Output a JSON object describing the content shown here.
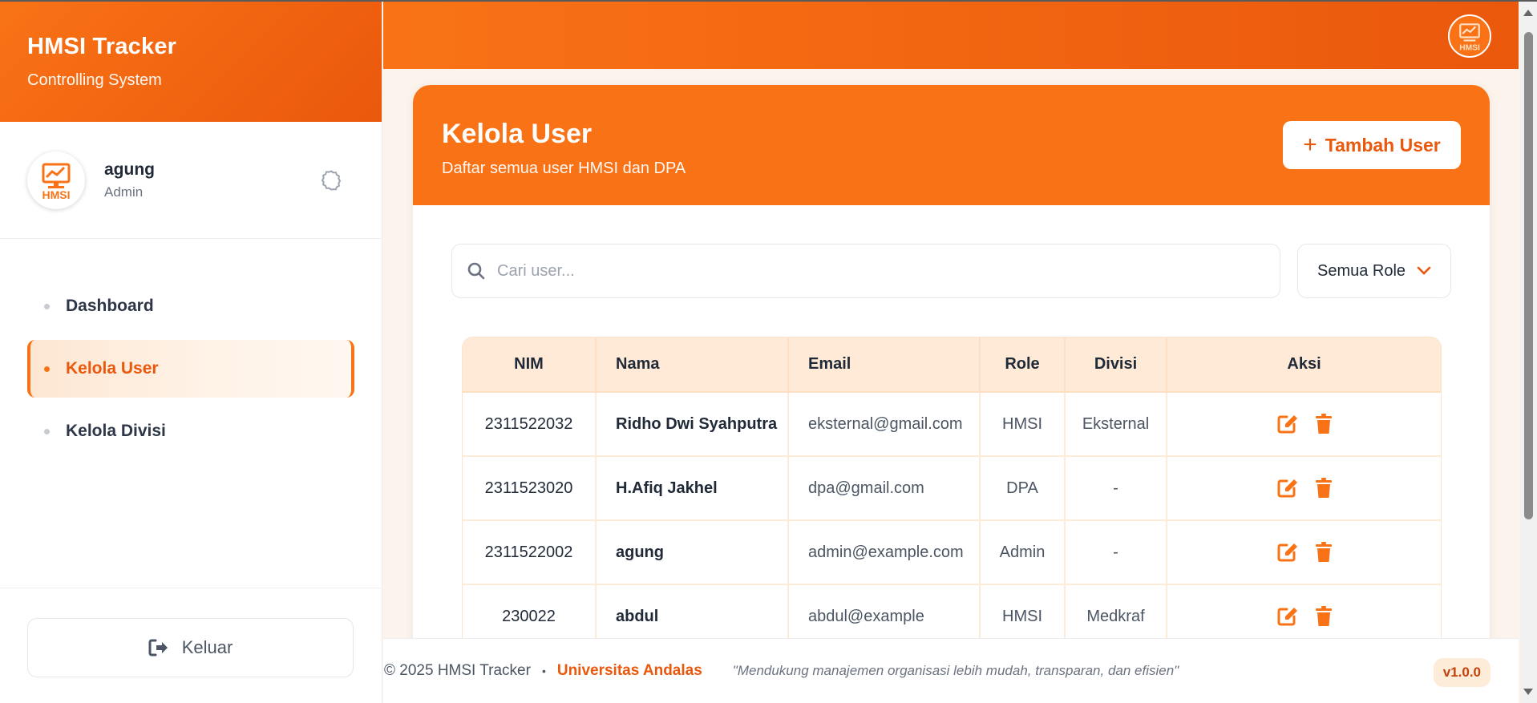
{
  "brand": {
    "title": "HMSI Tracker",
    "subtitle": "Controlling System"
  },
  "profile": {
    "name": "agung",
    "role": "Admin",
    "avatar_text": "HMSI"
  },
  "nav": [
    {
      "label": "Dashboard",
      "active": false
    },
    {
      "label": "Kelola User",
      "active": true
    },
    {
      "label": "Kelola Divisi",
      "active": false
    }
  ],
  "logout_label": "Keluar",
  "header": {
    "logo_text": "HMSI"
  },
  "page": {
    "title": "Kelola User",
    "subtitle": "Daftar semua user HMSI dan DPA",
    "add_button": "Tambah User",
    "search_placeholder": "Cari user...",
    "role_filter": "Semua Role"
  },
  "table": {
    "headers": [
      "NIM",
      "Nama",
      "Email",
      "Role",
      "Divisi",
      "Aksi"
    ],
    "rows": [
      {
        "nim": "2311522032",
        "nama": "Ridho Dwi Syahputra",
        "email": "eksternal@gmail.com",
        "role": "HMSI",
        "divisi": "Eksternal"
      },
      {
        "nim": "2311523020",
        "nama": "H.Afiq Jakhel",
        "email": "dpa@gmail.com",
        "role": "DPA",
        "divisi": "-"
      },
      {
        "nim": "2311522002",
        "nama": "agung",
        "email": "admin@example.com",
        "role": "Admin",
        "divisi": "-"
      },
      {
        "nim": "230022",
        "nama": "abdul",
        "email": "abdul@example",
        "role": "HMSI",
        "divisi": "Medkraf"
      }
    ]
  },
  "footer": {
    "copyright": "© 2025 HMSI Tracker",
    "separator": "•",
    "university": "Universitas Andalas",
    "tagline": "\"Mendukung manajemen organisasi lebih mudah, transparan, dan efisien\"",
    "version": "v1.0.0"
  },
  "colors": {
    "accent": "#f97316",
    "accent_dark": "#ea580c",
    "table_head": "#feead6"
  }
}
